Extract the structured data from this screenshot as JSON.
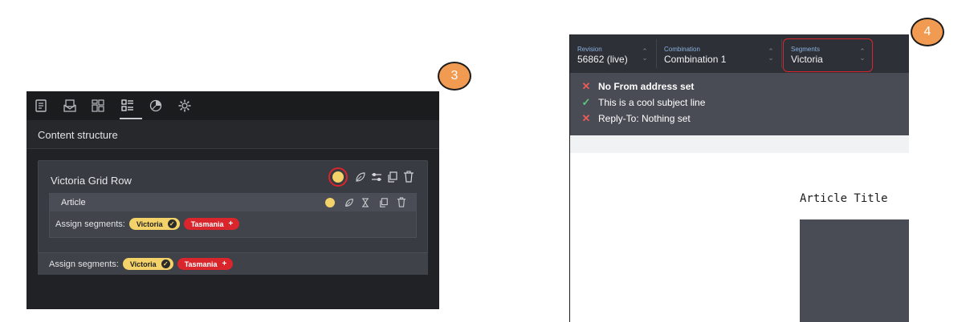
{
  "badges": {
    "panel3": "3",
    "panel4": "4"
  },
  "colors": {
    "accent_yellow": "#f4d26a",
    "accent_red": "#d8262c",
    "badge_orange": "#f19b52",
    "success_green": "#5fc67e",
    "error_red": "#ea5b5b"
  },
  "panel3": {
    "toolbar_icons": [
      "document-icon",
      "mail-icon",
      "grid-layout-icon",
      "content-structure-icon",
      "segments-icon",
      "settings-icon"
    ],
    "section_title": "Content structure",
    "grid_row": {
      "title": "Victoria Grid Row",
      "action_icons": [
        "segment-dot-icon",
        "leaf-icon",
        "sliders-icon",
        "copy-icon",
        "trash-icon"
      ]
    },
    "article": {
      "title": "Article",
      "action_icons": [
        "segment-dot-icon",
        "leaf-icon",
        "hourglass-icon",
        "copy-icon",
        "trash-icon"
      ],
      "assign_label": "Assign segments:",
      "segments": [
        {
          "name": "Victoria",
          "state": "selected"
        },
        {
          "name": "Tasmania",
          "state": "add"
        }
      ]
    },
    "row_assign": {
      "label": "Assign segments:",
      "segments": [
        {
          "name": "Victoria",
          "state": "selected"
        },
        {
          "name": "Tasmania",
          "state": "add"
        }
      ]
    }
  },
  "panel4": {
    "fields": [
      {
        "label": "Revision",
        "value": "56862 (live)"
      },
      {
        "label": "Combination",
        "value": "Combination 1"
      },
      {
        "label": "Segments",
        "value": "Victoria"
      }
    ],
    "checks": [
      {
        "status": "error",
        "text": "No From address set"
      },
      {
        "status": "ok",
        "text": "This is a cool subject line"
      },
      {
        "status": "error",
        "text": "Reply-To: Nothing set"
      }
    ],
    "preview": {
      "heading": "Article Title"
    }
  }
}
